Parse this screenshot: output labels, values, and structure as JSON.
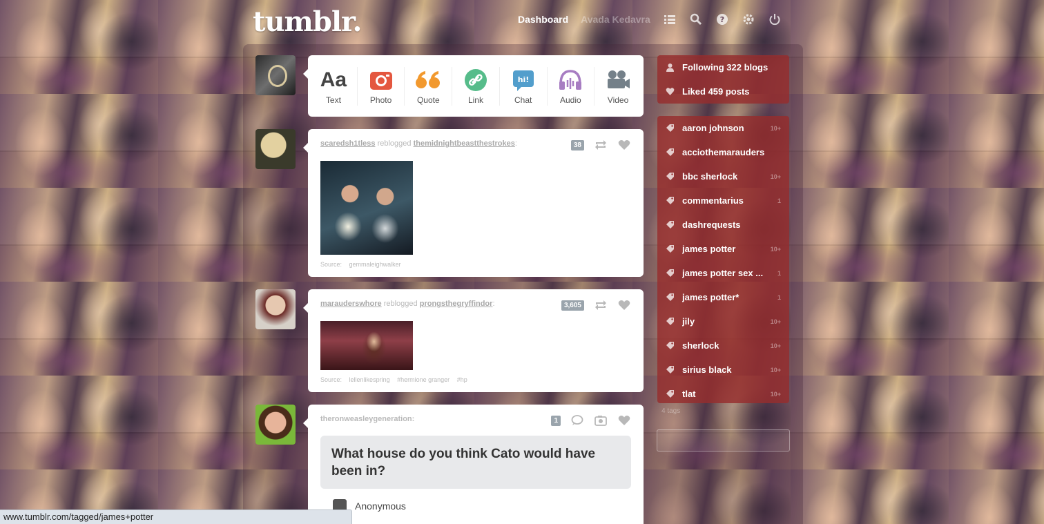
{
  "header": {
    "logo": "tumblr.",
    "nav": {
      "dashboard": "Dashboard",
      "secondary": "Avada Kedavra"
    }
  },
  "composer": {
    "items": [
      {
        "label": "Text",
        "icon": "text-icon"
      },
      {
        "label": "Photo",
        "icon": "camera-icon"
      },
      {
        "label": "Quote",
        "icon": "quote-icon"
      },
      {
        "label": "Link",
        "icon": "link-icon"
      },
      {
        "label": "Chat",
        "icon": "chat-icon"
      },
      {
        "label": "Audio",
        "icon": "headphones-icon"
      },
      {
        "label": "Video",
        "icon": "video-camera-icon"
      }
    ],
    "colors": {
      "photo": "#e4573f",
      "quote": "#f2992e",
      "link": "#56bc8a",
      "chat": "#529ecc",
      "audio": "#a77dc2",
      "video": "#748089"
    }
  },
  "posts": [
    {
      "user": "scaredsh1tless",
      "action": "reblogged",
      "source_user": "themidnightbeastthestrokes",
      "notes": "38",
      "source_label": "Source:",
      "source": "gemmaleighwalker"
    },
    {
      "user": "marauderswhore",
      "action": "reblogged",
      "source_user": "prongsthegryffindor",
      "notes": "3,605",
      "source_label": "Source:",
      "source": "lellenlikespring",
      "tags": [
        "#hermione granger",
        "#hp"
      ]
    },
    {
      "user": "theronweasleygeneration:",
      "notes": "1",
      "question": "What house do you think Cato would have been in?",
      "asker": "Anonymous"
    }
  ],
  "sidebar": {
    "following": "Following 322 blogs",
    "liked": "Liked 459 posts",
    "tags": [
      {
        "label": "aaron johnson",
        "count": "10+"
      },
      {
        "label": "acciothemarauders",
        "count": ""
      },
      {
        "label": "bbc sherlock",
        "count": "10+"
      },
      {
        "label": "commentarius",
        "count": "1"
      },
      {
        "label": "dashrequests",
        "count": ""
      },
      {
        "label": "james potter",
        "count": "10+"
      },
      {
        "label": "james potter sex ...",
        "count": "1"
      },
      {
        "label": "james potter*",
        "count": "1"
      },
      {
        "label": "jily",
        "count": "10+"
      },
      {
        "label": "sherlock",
        "count": "10+"
      },
      {
        "label": "sirius black",
        "count": "10+"
      },
      {
        "label": "tlat",
        "count": "10+"
      }
    ],
    "more": "4 tags"
  },
  "statusbar": {
    "url": "www.tumblr.com/tagged/james+potter"
  },
  "colors": {
    "sidebar": "#962d2d",
    "notes_badge": "#9aa4ac"
  }
}
